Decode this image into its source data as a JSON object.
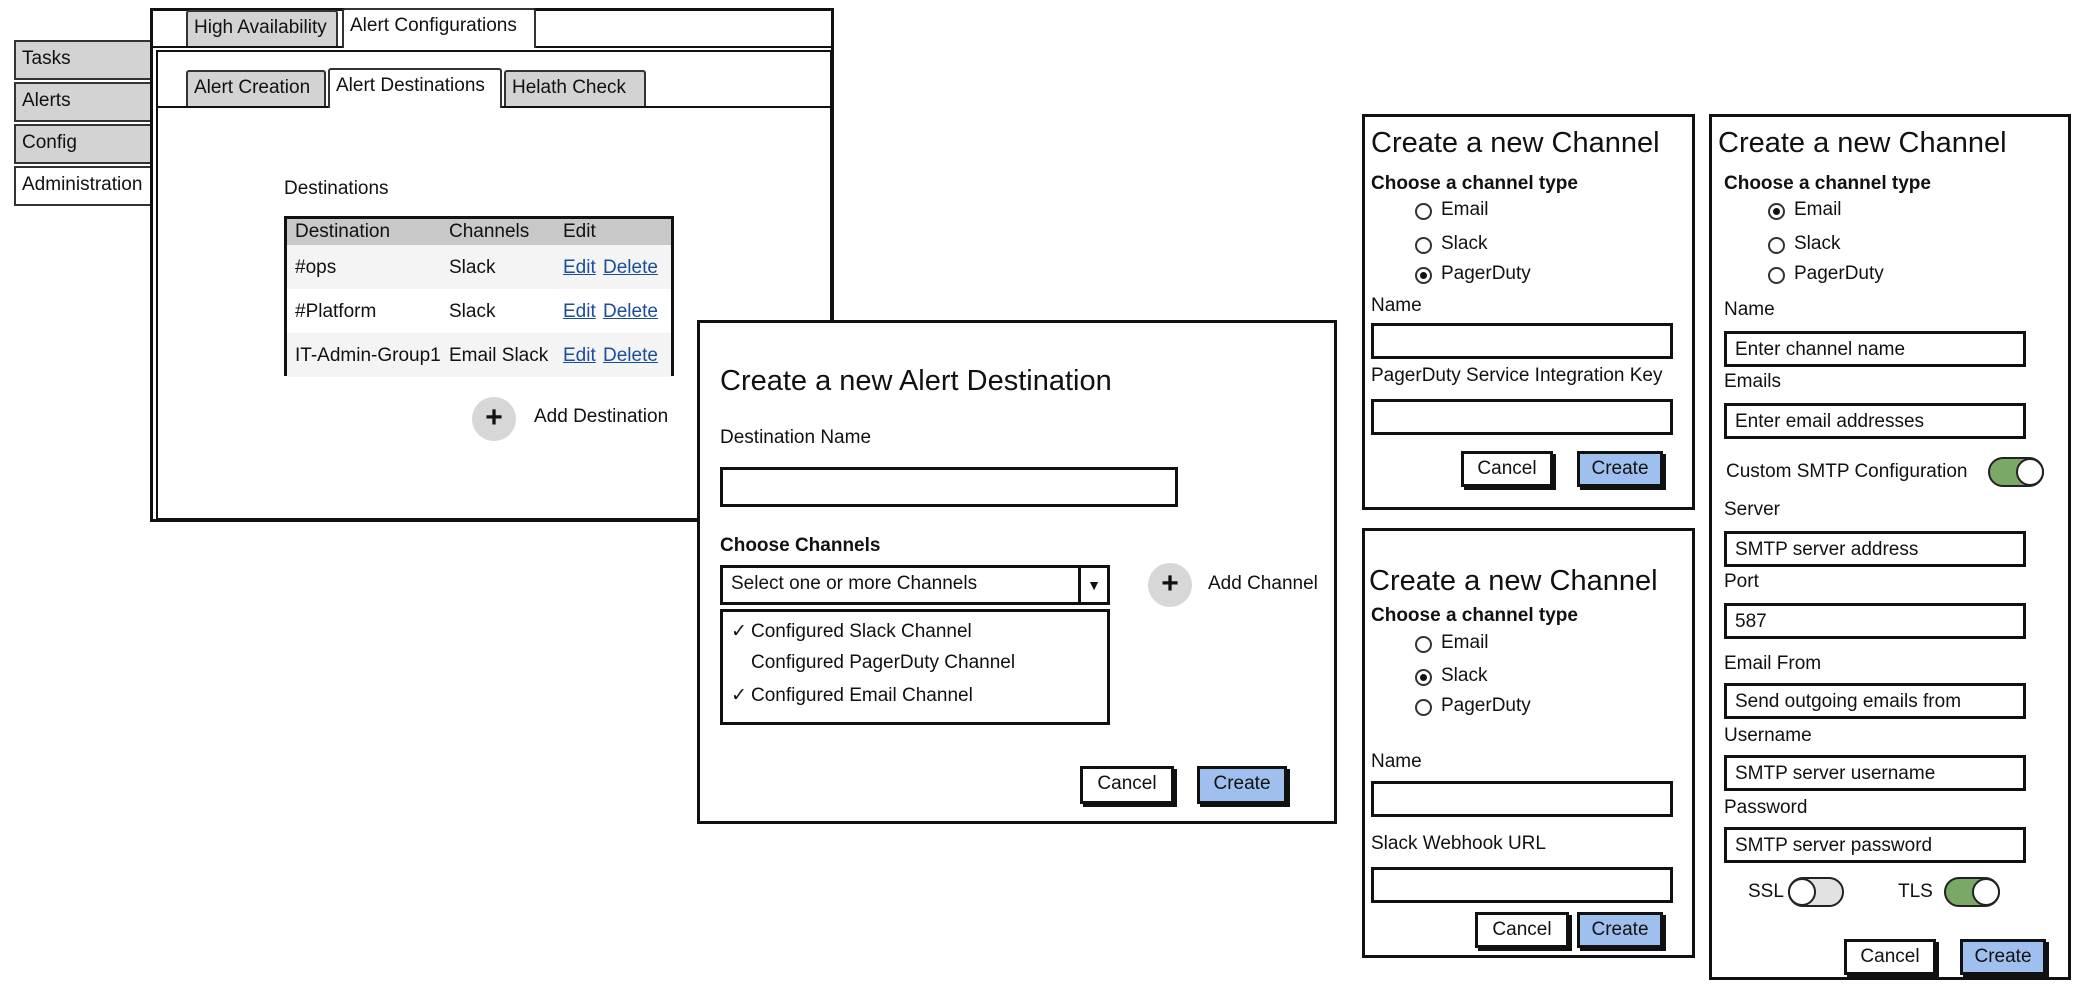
{
  "nav": {
    "items": [
      {
        "label": "Tasks"
      },
      {
        "label": "Alerts"
      },
      {
        "label": "Config"
      },
      {
        "label": "Administration"
      }
    ]
  },
  "top_tabs": [
    "High Availability",
    "Alert Configurations"
  ],
  "sub_tabs": [
    "Alert Creation",
    "Alert Destinations",
    "Helath Check"
  ],
  "destinations": {
    "heading": "Destinations",
    "columns": [
      "Destination",
      "Channels",
      "Edit"
    ],
    "rows": [
      {
        "destination": "#ops",
        "channels": "Slack",
        "edit": "Edit",
        "delete": "Delete"
      },
      {
        "destination": "#Platform",
        "channels": "Slack",
        "edit": "Edit",
        "delete": "Delete"
      },
      {
        "destination": "IT-Admin-Group1",
        "channels": "Email Slack",
        "edit": "Edit",
        "delete": "Delete"
      }
    ],
    "add_label": "Add Destination",
    "add_icon": "plus-icon"
  },
  "alert_dialog": {
    "title": "Create a new Alert Destination",
    "name_label": "Destination Name",
    "name_value": "",
    "channels_label": "Choose Channels",
    "select_placeholder": "Select one or more Channels",
    "options": [
      {
        "label": "Configured Slack Channel",
        "checked": true
      },
      {
        "label": "Configured PagerDuty Channel",
        "checked": false
      },
      {
        "label": "Configured Email Channel",
        "checked": true
      }
    ],
    "add_channel_label": "Add Channel",
    "cancel": "Cancel",
    "create": "Create"
  },
  "pagerduty_dialog": {
    "title": "Create a new Channel",
    "type_label": "Choose a channel type",
    "types": [
      {
        "label": "Email",
        "selected": false
      },
      {
        "label": "Slack",
        "selected": false
      },
      {
        "label": "PagerDuty",
        "selected": true
      }
    ],
    "name_label": "Name",
    "key_label": "PagerDuty Service Integration Key",
    "cancel": "Cancel",
    "create": "Create"
  },
  "slack_dialog": {
    "title": "Create a new Channel",
    "type_label": "Choose a channel type",
    "types": [
      {
        "label": "Email",
        "selected": false
      },
      {
        "label": "Slack",
        "selected": true
      },
      {
        "label": "PagerDuty",
        "selected": false
      }
    ],
    "name_label": "Name",
    "webhook_label": "Slack Webhook URL",
    "cancel": "Cancel",
    "create": "Create"
  },
  "email_dialog": {
    "title": "Create a new Channel",
    "type_label": "Choose a channel type",
    "types": [
      {
        "label": "Email",
        "selected": true
      },
      {
        "label": "Slack",
        "selected": false
      },
      {
        "label": "PagerDuty",
        "selected": false
      }
    ],
    "name_label": "Name",
    "name_placeholder": "Enter channel name",
    "emails_label": "Emails",
    "emails_placeholder": "Enter email addresses",
    "smtp_label": "Custom SMTP Configuration",
    "smtp_on": true,
    "server_label": "Server",
    "server_placeholder": "SMTP server address",
    "port_label": "Port",
    "port_value": "587",
    "from_label": "Email From",
    "from_placeholder": "Send outgoing emails from",
    "username_label": "Username",
    "username_placeholder": "SMTP server username",
    "password_label": "Password",
    "password_placeholder": "SMTP server password",
    "ssl_label": "SSL",
    "ssl_on": false,
    "tls_label": "TLS",
    "tls_on": true,
    "cancel": "Cancel",
    "create": "Create"
  }
}
